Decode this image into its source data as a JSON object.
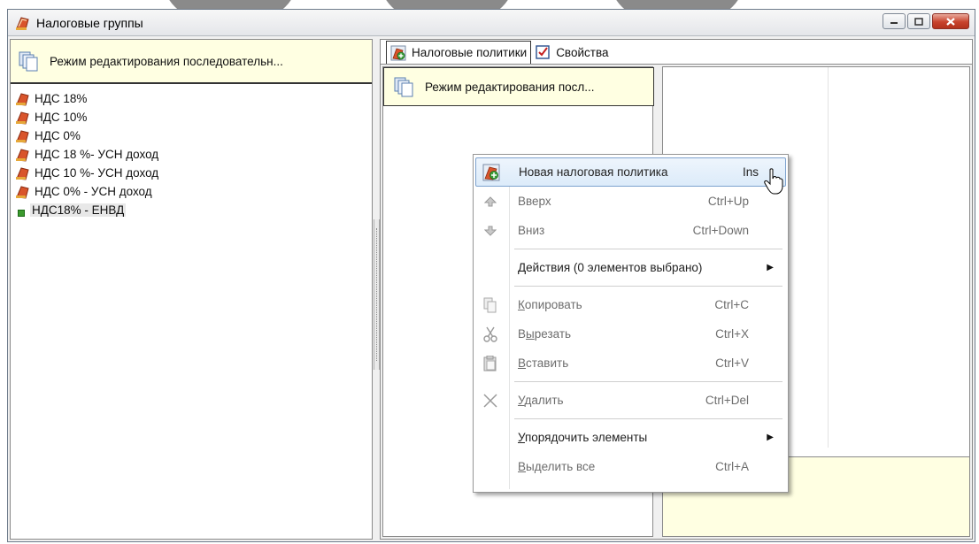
{
  "window": {
    "title": "Налоговые группы"
  },
  "left_panel": {
    "header": "Режим редактирования последовательн...",
    "tree_items": [
      {
        "label": "НДС 18%"
      },
      {
        "label": "НДС 10%"
      },
      {
        "label": "НДС 0%"
      },
      {
        "label": "НДС 18 %- УСН доход"
      },
      {
        "label": "НДС 10 %- УСН доход"
      },
      {
        "label": "НДС 0% - УСН доход"
      },
      {
        "label": "НДС18% - ЕНВД"
      }
    ]
  },
  "tabs": [
    {
      "label": "Налоговые политики",
      "icon": "tax-policy-icon"
    },
    {
      "label": "Свойства",
      "icon": "properties-icon"
    }
  ],
  "inner_panel": {
    "header": "Режим редактирования посл..."
  },
  "context_menu": {
    "items": [
      {
        "label": "Новая налоговая политика",
        "shortcut": "Ins",
        "icon": "new-policy-icon",
        "highlighted": true
      },
      {
        "label": "Вверх",
        "shortcut": "Ctrl+Up",
        "icon": "arrow-up-icon"
      },
      {
        "label": "Вниз",
        "shortcut": "Ctrl+Down",
        "icon": "arrow-down-icon"
      },
      {
        "label": "Действия (0 элементов выбрано)",
        "submenu": true
      },
      {
        "label_u": "К",
        "label_rest": "опировать",
        "shortcut": "Ctrl+C",
        "icon": "copy-icon"
      },
      {
        "label_pre": "В",
        "label_u": "ы",
        "label_rest": "резать",
        "shortcut": "Ctrl+X",
        "icon": "cut-icon"
      },
      {
        "label_u": "В",
        "label_rest": "ставить",
        "shortcut": "Ctrl+V",
        "icon": "paste-icon"
      },
      {
        "label_u": "У",
        "label_rest": "далить",
        "shortcut": "Ctrl+Del",
        "icon": "delete-icon"
      },
      {
        "label_u": "У",
        "label_rest": "порядочить элементы",
        "submenu": true
      },
      {
        "label_u": "В",
        "label_rest": "ыделить все",
        "shortcut": "Ctrl+A"
      }
    ]
  },
  "colors": {
    "header_yellow": "#ffffe2",
    "highlight_border": "#7da2ce",
    "close_button": "#c8432d"
  }
}
